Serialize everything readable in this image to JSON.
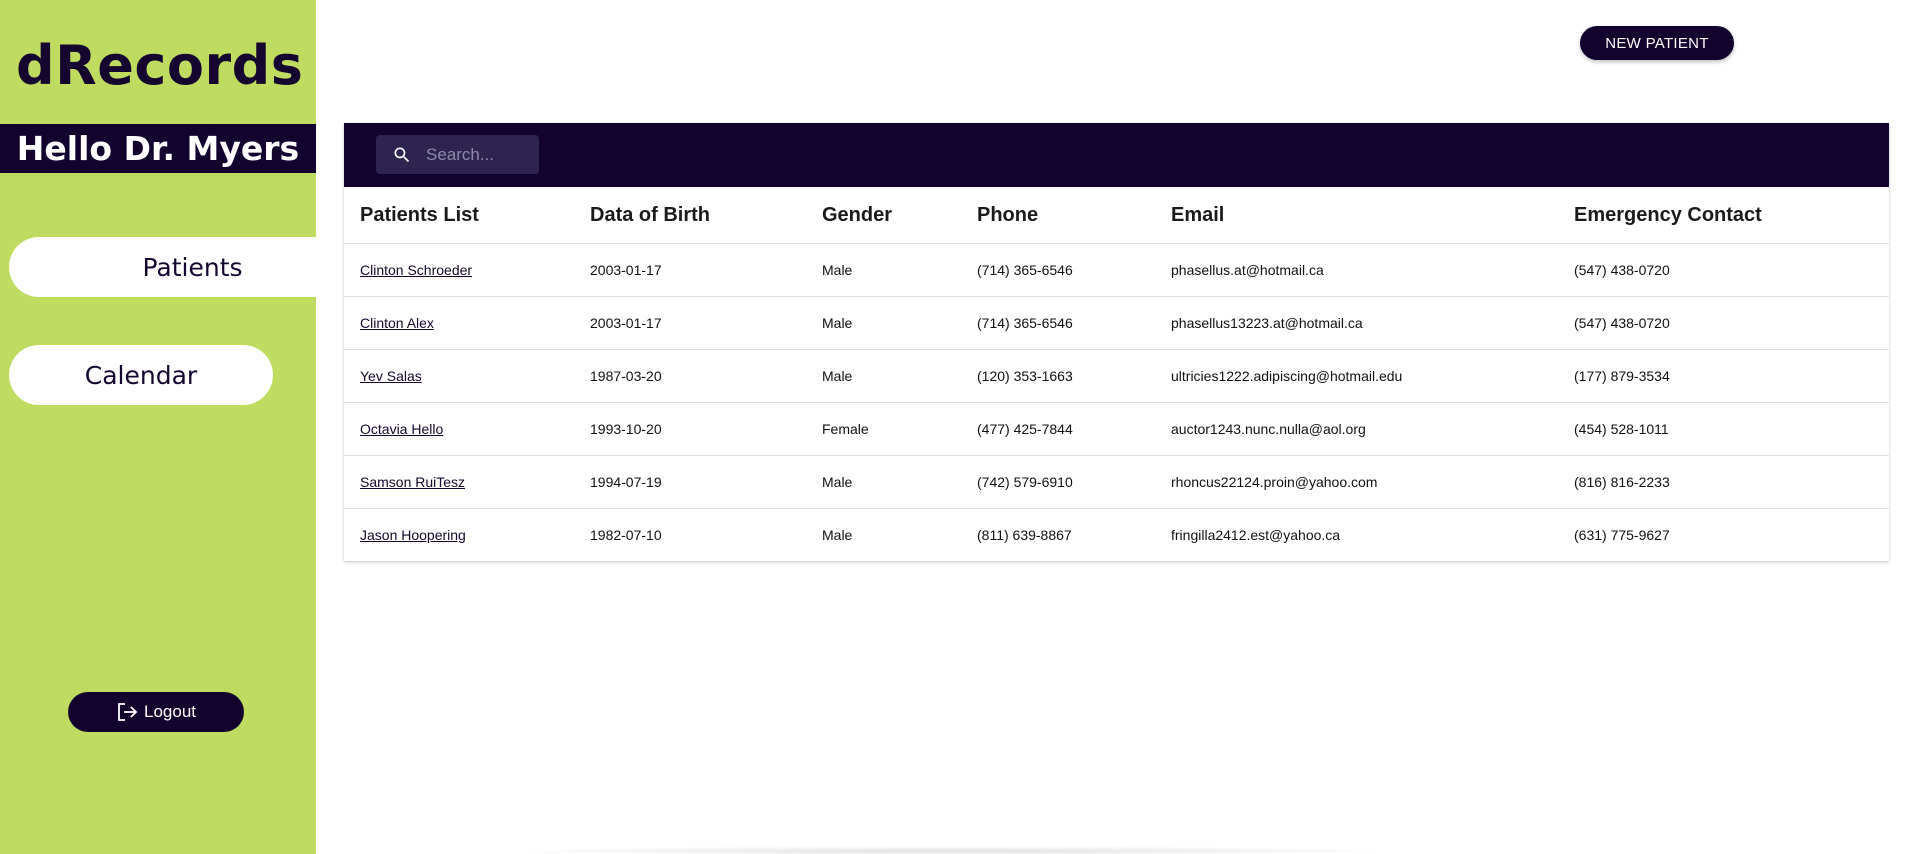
{
  "app": {
    "brand": "dRecords",
    "greeting": "Hello Dr. Myers"
  },
  "sidebar": {
    "items": [
      {
        "label": "Patients",
        "active": true
      },
      {
        "label": "Calendar",
        "active": false
      }
    ],
    "logout_label": "Logout"
  },
  "header": {
    "new_patient_label": "NEW PATIENT"
  },
  "search": {
    "placeholder": "Search..."
  },
  "table": {
    "columns": [
      "Patients List",
      "Data of Birth",
      "Gender",
      "Phone",
      "Email",
      "Emergency Contact"
    ],
    "rows": [
      {
        "name": "Clinton Schroeder",
        "dob": "2003-01-17",
        "gender": "Male",
        "phone": "(714) 365-6546",
        "email": "phasellus.at@hotmail.ca",
        "emergency": "(547) 438-0720"
      },
      {
        "name": "Clinton Alex",
        "dob": "2003-01-17",
        "gender": "Male",
        "phone": "(714) 365-6546",
        "email": "phasellus13223.at@hotmail.ca",
        "emergency": "(547) 438-0720"
      },
      {
        "name": "Yev Salas",
        "dob": "1987-03-20",
        "gender": "Male",
        "phone": "(120) 353-1663",
        "email": "ultricies1222.adipiscing@hotmail.edu",
        "emergency": "(177) 879-3534"
      },
      {
        "name": "Octavia Hello",
        "dob": "1993-10-20",
        "gender": "Female",
        "phone": "(477) 425-7844",
        "email": "auctor1243.nunc.nulla@aol.org",
        "emergency": "(454) 528-1011"
      },
      {
        "name": "Samson RuiTesz",
        "dob": "1994-07-19",
        "gender": "Male",
        "phone": "(742) 579-6910",
        "email": "rhoncus22124.proin@yahoo.com",
        "emergency": "(816) 816-2233"
      },
      {
        "name": "Jason Hoopering",
        "dob": "1982-07-10",
        "gender": "Male",
        "phone": "(811) 639-8867",
        "email": "fringilla2412.est@yahoo.ca",
        "emergency": "(631) 775-9627"
      }
    ]
  },
  "colors": {
    "sidebar_bg": "#bfdc60",
    "primary_dark": "#12032e",
    "search_bg": "#2e2450"
  },
  "icons": {
    "search": "search-icon",
    "logout": "logout-icon"
  }
}
